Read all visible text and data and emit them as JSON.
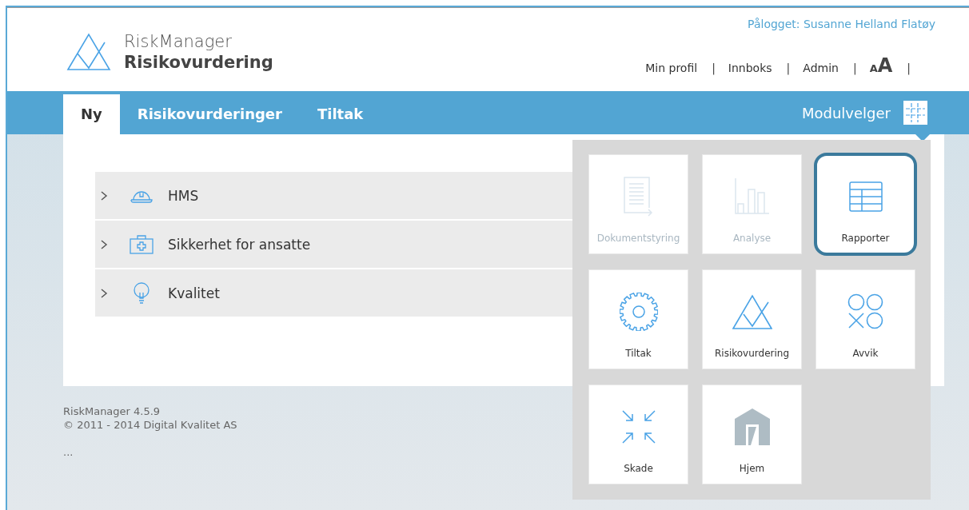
{
  "header": {
    "product": "RiskManager",
    "module": "Risikovurdering",
    "logged_in": "Pålogget: Susanne Helland Flatøy",
    "separator": "|",
    "links": [
      {
        "label": "Min profil"
      },
      {
        "label": "Innboks"
      },
      {
        "label": "Admin"
      }
    ],
    "font_small": "A",
    "font_large": "A"
  },
  "tabs": [
    {
      "label": "Ny",
      "selected": true
    },
    {
      "label": "Risikovurderinger",
      "selected": false
    },
    {
      "label": "Tiltak",
      "selected": false
    }
  ],
  "module_picker": {
    "label": "Modulvelger",
    "expanded": true,
    "tiles": [
      {
        "label": "Dokumentstyring",
        "disabled": true,
        "selected": false
      },
      {
        "label": "Analyse",
        "disabled": true,
        "selected": false
      },
      {
        "label": "Rapporter",
        "disabled": false,
        "selected": true
      },
      {
        "label": "Tiltak",
        "disabled": false,
        "selected": false
      },
      {
        "label": "Risikovurdering",
        "disabled": false,
        "selected": false
      },
      {
        "label": "Avvik",
        "disabled": false,
        "selected": false
      },
      {
        "label": "Skade",
        "disabled": false,
        "selected": false
      },
      {
        "label": "Hjem",
        "disabled": false,
        "selected": false
      }
    ]
  },
  "categories": [
    {
      "label": "HMS",
      "expanded": false
    },
    {
      "label": "Sikkerhet for ansatte",
      "expanded": false
    },
    {
      "label": "Kvalitet",
      "expanded": false
    }
  ],
  "footer": {
    "version": "RiskManager 4.5.9",
    "copyright": "© 2011 - 2014 Digital Kvalitet AS",
    "more": "..."
  }
}
